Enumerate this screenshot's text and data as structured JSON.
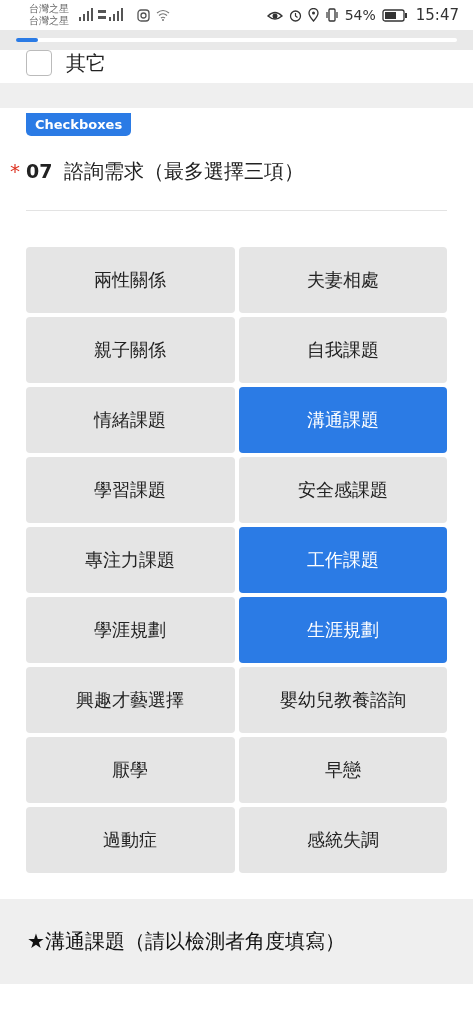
{
  "status_bar": {
    "carriers": [
      "台灣之星",
      "台灣之星"
    ],
    "battery": "54%",
    "time": "15:47"
  },
  "progress": {
    "level": 0.05
  },
  "previous_option": {
    "label": "其它",
    "checked": false
  },
  "question": {
    "type_badge": "Checkboxes",
    "required_mark": "*",
    "number": "07",
    "title": "諮詢需求（最多選擇三項）",
    "options": [
      {
        "label": "兩性關係",
        "selected": false
      },
      {
        "label": "夫妻相處",
        "selected": false
      },
      {
        "label": "親子關係",
        "selected": false
      },
      {
        "label": "自我課題",
        "selected": false
      },
      {
        "label": "情緒課題",
        "selected": false
      },
      {
        "label": "溝通課題",
        "selected": true
      },
      {
        "label": "學習課題",
        "selected": false
      },
      {
        "label": "安全感課題",
        "selected": false
      },
      {
        "label": "專注力課題",
        "selected": false
      },
      {
        "label": "工作課題",
        "selected": true
      },
      {
        "label": "學涯規劃",
        "selected": false
      },
      {
        "label": "生涯規劃",
        "selected": true
      },
      {
        "label": "興趣才藝選擇",
        "selected": false
      },
      {
        "label": "嬰幼兒教養諮詢",
        "selected": false
      },
      {
        "label": "厭學",
        "selected": false
      },
      {
        "label": "早戀",
        "selected": false
      },
      {
        "label": "過動症",
        "selected": false
      },
      {
        "label": "感統失調",
        "selected": false
      }
    ]
  },
  "section_heading": "★溝通課題（請以檢測者角度填寫）"
}
